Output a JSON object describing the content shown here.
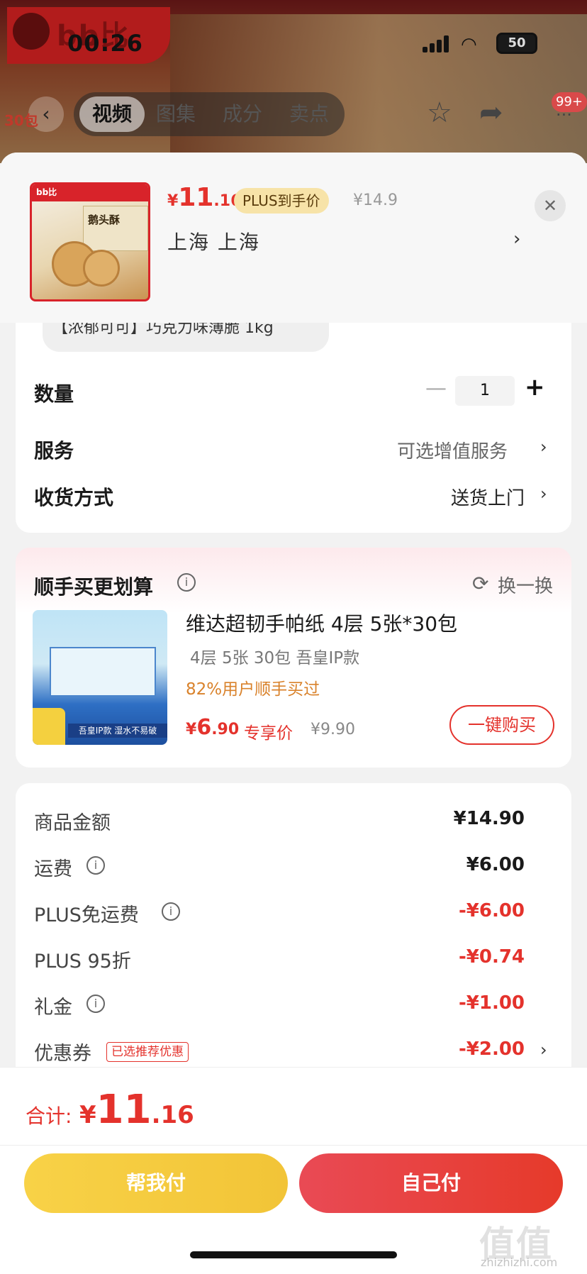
{
  "status_bar": {
    "time": "00:26",
    "battery": "50"
  },
  "background": {
    "brand_logo": "bb比",
    "tabs": [
      "视频",
      "图集",
      "成分",
      "卖点"
    ],
    "badge": "99+"
  },
  "product": {
    "price_currency": "¥",
    "price_int": "11",
    "price_dec": ".16",
    "plus_tag": "PLUS到手价",
    "original_price": "¥14.9",
    "address": "上海 上海",
    "thumb_logo": "bb比",
    "thumb_title": "鹅头酥"
  },
  "variant": {
    "label": "【浓郁可可】巧克力味薄脆 1kg"
  },
  "options": {
    "quantity_label": "数量",
    "quantity_value": "1",
    "service_label": "服务",
    "service_value": "可选增值服务",
    "delivery_label": "收货方式",
    "delivery_value": "送货上门"
  },
  "recommend": {
    "title": "顺手买更划算",
    "refresh_label": "换一换",
    "name": "维达超韧手帕纸 4层 5张*30包",
    "spec": "4层 5张 30包 吾皇IP款",
    "bought_pct": "82%用户顺手买过",
    "price_currency": "¥",
    "price_int": "6",
    "price_dec": ".90",
    "exclusive_label": "专享价",
    "original_price": "¥9.90",
    "buy_button": "一键购买",
    "badge": "30包",
    "strip": "吾皇IP款 湿水不易破"
  },
  "fees": [
    {
      "label": "商品金额",
      "value": "¥14.90"
    },
    {
      "label": "运费",
      "value": "¥6.00"
    },
    {
      "label": "PLUS免运费",
      "value": "-¥6.00"
    },
    {
      "label": "PLUS 95折",
      "value": "-¥0.74"
    },
    {
      "label": "礼金",
      "value": "-¥1.00"
    },
    {
      "label": "优惠券",
      "value": "-¥2.00"
    }
  ],
  "coupon_tag": "已选推荐优惠",
  "footer": {
    "total_label": "合计:",
    "total_currency": "¥",
    "total_int": "11",
    "total_dec": ".16",
    "help_pay": "帮我付",
    "self_pay": "自己付"
  },
  "watermark": {
    "main": "值值值",
    "sub": "zhizhizhi.com"
  },
  "colors": {
    "accent_red": "#e4322c",
    "plus_gold": "#f7e3a8",
    "help_yellow": "#f8d247"
  }
}
